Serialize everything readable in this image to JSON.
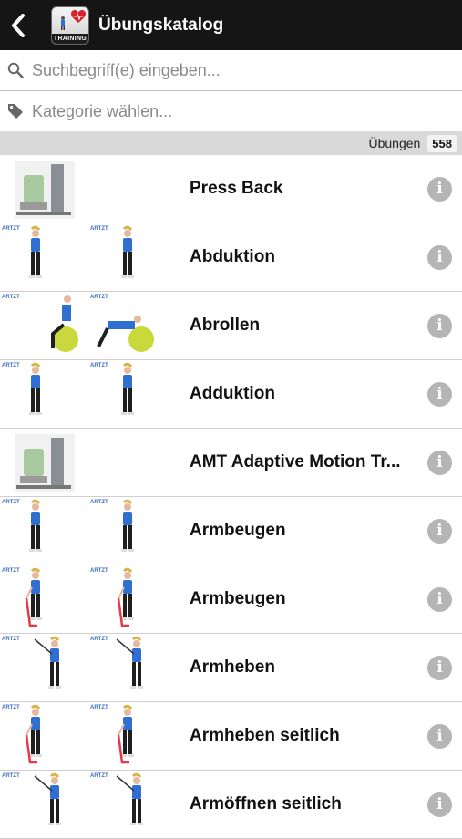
{
  "header": {
    "title": "Übungskatalog",
    "app_icon_label": "TRAINING"
  },
  "search": {
    "placeholder": "Suchbegriff(e) eingeben..."
  },
  "category": {
    "placeholder": "Kategorie wählen..."
  },
  "summary": {
    "label": "Übungen",
    "count": "558"
  },
  "exercises": [
    {
      "name": "Press Back",
      "thumb": "machine"
    },
    {
      "name": "Abduktion",
      "thumb": "standing-figures"
    },
    {
      "name": "Abrollen",
      "thumb": "ball-figures"
    },
    {
      "name": "Adduktion",
      "thumb": "standing-figures"
    },
    {
      "name": "AMT Adaptive Motion Tr...",
      "thumb": "machine"
    },
    {
      "name": "Armbeugen",
      "thumb": "standing-figures"
    },
    {
      "name": "Armbeugen",
      "thumb": "band-figures"
    },
    {
      "name": "Armheben",
      "thumb": "cable-figures"
    },
    {
      "name": "Armheben seitlich",
      "thumb": "band-figures"
    },
    {
      "name": "Armöffnen seitlich",
      "thumb": "cable-figures"
    }
  ],
  "thumb_brand": "ARTZT",
  "icons": {
    "back": "chevron-left-icon",
    "search": "search-icon",
    "category": "tag-icon",
    "info": "info-icon"
  },
  "colors": {
    "header_bg": "#151515",
    "count_bar_bg": "#d9d9d9",
    "info_icon": "#b5b5b5",
    "figure_top": "#2f6fd1",
    "ball": "#c9d83a",
    "band": "#e23b4a"
  }
}
